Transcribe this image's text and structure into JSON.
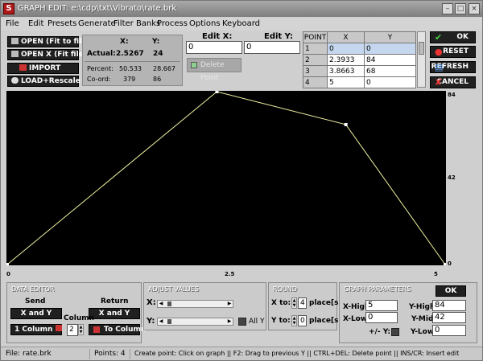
{
  "window": {
    "title": "GRAPH EDIT: e:\\cdp\\txt\\Vibrato\\rate.brk",
    "app_icon": "S"
  },
  "menu": [
    "File",
    "Edit",
    "Presets",
    "Generate",
    "Filter Banks",
    "Process",
    "Options",
    "Keyboard"
  ],
  "left_buttons": {
    "open_fit": "OPEN (Fit to file)",
    "open_x_fit": "OPEN X (Fit file)",
    "import": "IMPORT",
    "load_rescale": "LOAD+Rescale"
  },
  "readout": {
    "x_header": "X:",
    "y_header": "Y:",
    "actual_label": "Actual:",
    "actual_x": "2.5267",
    "actual_y": "24",
    "percent_label": "Percent:",
    "percent_x": "50.533",
    "percent_y": "28.667",
    "coord_label": "Co-ord:",
    "coord_x": "379",
    "coord_y": "86"
  },
  "edit": {
    "edit_x_label": "Edit X:",
    "edit_y_label": "Edit Y:",
    "edit_x_value": "0",
    "edit_y_value": "0",
    "delete_point": "Delete Point"
  },
  "points_table": {
    "headers": [
      "POINT",
      "X",
      "Y"
    ],
    "rows": [
      {
        "point": "1",
        "x": "0",
        "y": "0"
      },
      {
        "point": "2",
        "x": "2.3933",
        "y": "84"
      },
      {
        "point": "3",
        "x": "3.8663",
        "y": "68"
      },
      {
        "point": "4",
        "x": "5",
        "y": "0"
      }
    ]
  },
  "right_buttons": {
    "ok": "OK",
    "reset": "RESET",
    "refresh": "REFRESH",
    "cancel": "CANCEL"
  },
  "graph": {
    "y_high_label": "84",
    "y_mid_label": "42",
    "y_low_label": "0",
    "x_low_label": "0",
    "x_mid_label": "2.5",
    "x_high_label": "5",
    "line_color": "#f0f0a0"
  },
  "chart_data": {
    "type": "line",
    "x": [
      0,
      2.3933,
      3.8663,
      5
    ],
    "y": [
      0,
      84,
      68,
      0
    ],
    "xlim": [
      0,
      5
    ],
    "ylim": [
      0,
      84
    ]
  },
  "data_editor": {
    "title": "DATA EDITOR",
    "send_label": "Send",
    "return_label": "Return",
    "send_xy": "X and Y",
    "return_xy": "X and Y",
    "column_label": "Column",
    "one_column": "1 Column",
    "to_column": "To Column",
    "column_value": "2"
  },
  "adjust_values": {
    "title": "ADJUST VALUES",
    "x_label": "X:",
    "y_label": "Y:",
    "all_y": "All Y"
  },
  "round": {
    "title": "ROUND",
    "x_to": "X to:",
    "y_to": "Y to:",
    "x_places": "4",
    "y_places": "0",
    "places_label": "place[s]"
  },
  "graph_params": {
    "title": "GRAPH PARAMETERS",
    "ok": "OK",
    "x_high_label": "X-High:",
    "x_low_label": "X-Low:",
    "x_high": "5",
    "x_low": "0",
    "y_high_label": "Y-High:",
    "y_mid_label": "Y-Mid:",
    "y_low_label": "Y-Low:",
    "y_high": "84",
    "y_mid": "42",
    "y_low": "0",
    "plus_minus_y": "+/- Y:"
  },
  "status": {
    "file": "File: rate.brk",
    "points": "Points: 4",
    "hints": "Create point: Click on graph   ||   F2: Drag to previous Y   ||   CTRL+DEL: Delete point   ||   INS/CR: Insert edit"
  }
}
